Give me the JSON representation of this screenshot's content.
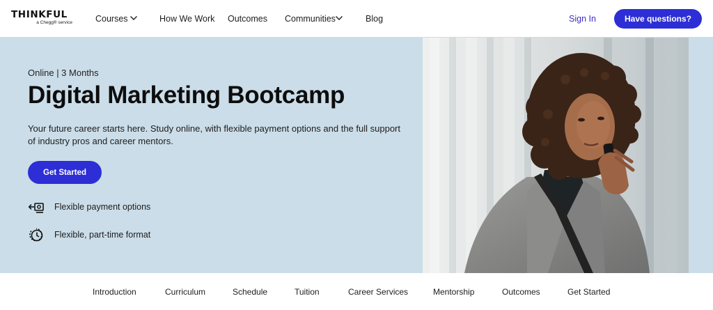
{
  "brand": {
    "name": "THINKFUL",
    "tagline": "a Chegg® service"
  },
  "nav": {
    "items": [
      {
        "label": "Courses",
        "has_dropdown": true
      },
      {
        "label": "How We Work",
        "has_dropdown": false
      },
      {
        "label": "Outcomes",
        "has_dropdown": false
      },
      {
        "label": "Communities",
        "has_dropdown": true
      },
      {
        "label": "Blog",
        "has_dropdown": false
      }
    ],
    "sign_in": "Sign In",
    "cta": "Have questions?"
  },
  "hero": {
    "eyebrow": "Online | 3 Months",
    "title": "Digital Marketing Bootcamp",
    "description": "Your future career starts here. Study online, with flexible payment options and the full support of industry pros and career mentors.",
    "cta": "Get Started",
    "features": [
      {
        "icon": "payment-icon",
        "label": "Flexible payment options"
      },
      {
        "icon": "clock-icon",
        "label": "Flexible, part-time format"
      }
    ]
  },
  "subnav": {
    "items": [
      "Introduction",
      "Curriculum",
      "Schedule",
      "Tuition",
      "Career Services",
      "Mentorship",
      "Outcomes",
      "Get Started"
    ]
  },
  "colors": {
    "accent": "#2d2ed6",
    "hero_bg": "#cbdde8",
    "sign_in": "#3b2fc9"
  }
}
